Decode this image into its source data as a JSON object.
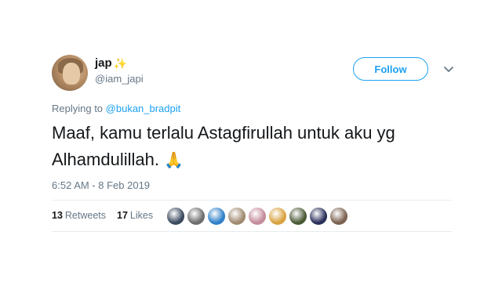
{
  "user": {
    "display_name": "jap",
    "emoji": "✨",
    "handle": "@iam_japi"
  },
  "follow_label": "Follow",
  "reply": {
    "prefix": "Replying to ",
    "target": "@bukan_bradpit"
  },
  "tweet": {
    "text": "Maaf, kamu terlalu Astagfirullah untuk aku yg Alhamdulillah.",
    "emoji": "🙏"
  },
  "timestamp": "6:52 AM - 8 Feb 2019",
  "stats": {
    "retweets_count": "13",
    "retweets_label": "Retweets",
    "likes_count": "17",
    "likes_label": "Likes"
  },
  "liker_avatar_colors": [
    "#3b4a5e",
    "#6d6d6d",
    "#2f80c8",
    "#a08a70",
    "#c48b9b",
    "#d9a23f",
    "#4a5a36",
    "#2a2f5a",
    "#7b6250"
  ]
}
